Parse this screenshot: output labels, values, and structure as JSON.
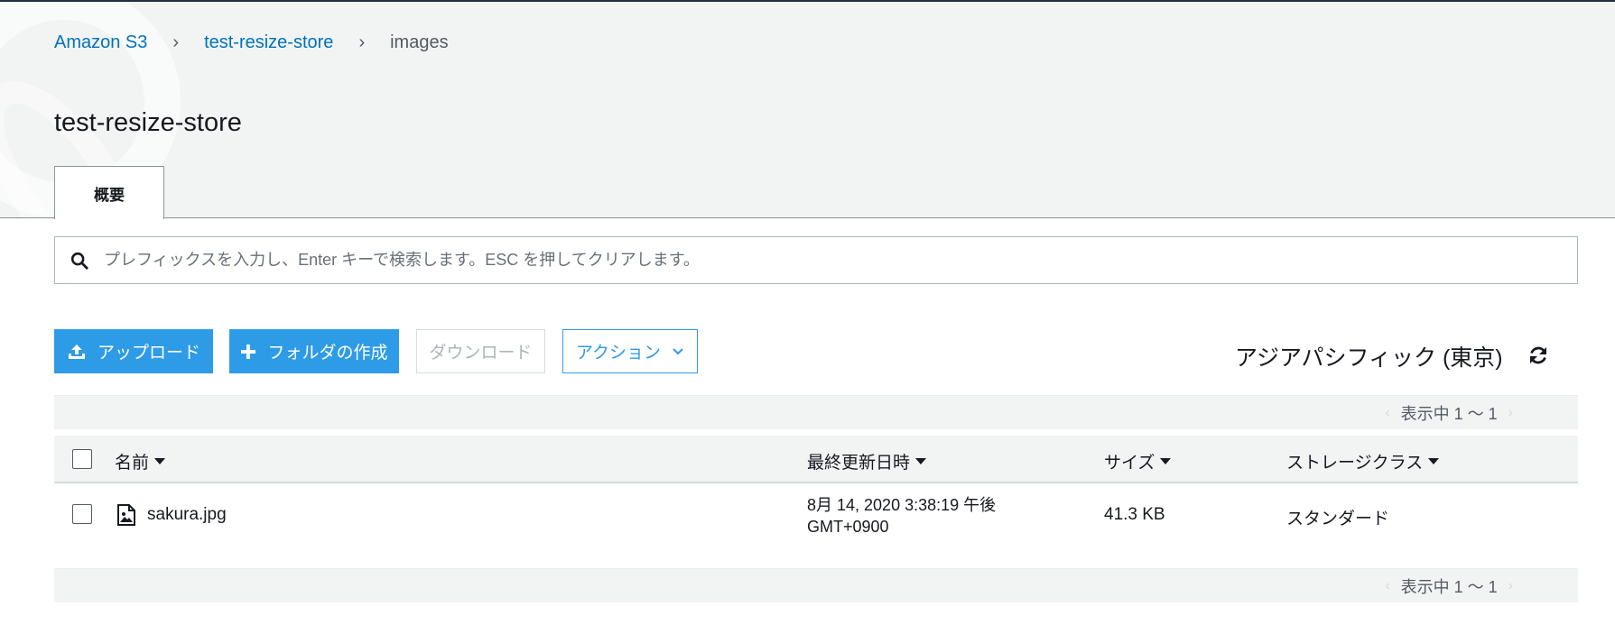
{
  "breadcrumb": {
    "root": "Amazon S3",
    "bucket": "test-resize-store",
    "current": "images"
  },
  "page_title": "test-resize-store",
  "tabs": [
    {
      "label": "概要",
      "active": true
    }
  ],
  "search": {
    "placeholder": "プレフィックスを入力し、Enter キーで検索します。ESC を押してクリアします。",
    "value": ""
  },
  "toolbar": {
    "upload_label": "アップロード",
    "create_folder_label": "フォルダの作成",
    "download_label": "ダウンロード",
    "actions_label": "アクション"
  },
  "region": "アジアパシフィック (東京)",
  "pager": {
    "label": "表示中 1 ～ 1",
    "prev_icon": "chevron-left-icon",
    "next_icon": "chevron-right-icon"
  },
  "table": {
    "columns": {
      "name": "名前",
      "modified": "最終更新日時",
      "size": "サイズ",
      "storage_class": "ストレージクラス"
    },
    "rows": [
      {
        "name": "sakura.jpg",
        "icon": "image-file-icon",
        "modified_line1": "8月 14, 2020 3:38:19 午後",
        "modified_line2": "GMT+0900",
        "size": "41.3 KB",
        "storage_class": "スタンダード"
      }
    ]
  },
  "colors": {
    "link": "#0073bb",
    "primary_button": "#2e9be6",
    "header_bg": "#f2f3f3",
    "top_border": "#232f3e"
  }
}
